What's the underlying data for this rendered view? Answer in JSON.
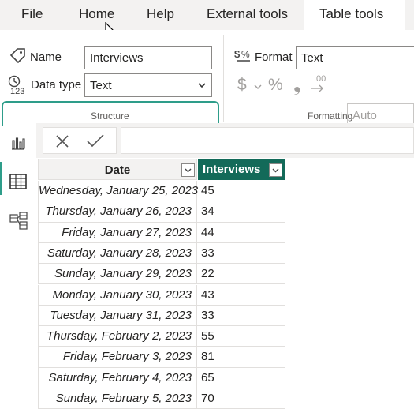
{
  "menu": {
    "tabs": [
      "File",
      "Home",
      "Help",
      "External tools",
      "Table tools"
    ],
    "active": "Table tools"
  },
  "ribbon": {
    "structure": {
      "name_label": "Name",
      "name_value": "Interviews",
      "datatype_label": "Data type",
      "datatype_value": "Text",
      "group_label": "Structure"
    },
    "formatting": {
      "format_label": "Format",
      "format_value": "Text",
      "currency_symbol": "$",
      "percent_symbol": "%",
      "comma_symbol": "❟",
      "decimal_symbol": ".00",
      "auto_placeholder": "Auto",
      "group_label": "Formatting"
    }
  },
  "left_rail": {
    "icons": [
      "report-view-icon",
      "table-view-icon",
      "model-view-icon"
    ],
    "active": "table-view-icon"
  },
  "table": {
    "columns": [
      "Date",
      "Interviews"
    ],
    "rows": [
      {
        "date": "Wednesday, January 25, 2023",
        "interviews": "45"
      },
      {
        "date": "Thursday, January 26, 2023",
        "interviews": "34"
      },
      {
        "date": "Friday, January 27, 2023",
        "interviews": "44"
      },
      {
        "date": "Saturday, January 28, 2023",
        "interviews": "33"
      },
      {
        "date": "Sunday, January 29, 2023",
        "interviews": "22"
      },
      {
        "date": "Monday, January 30, 2023",
        "interviews": "43"
      },
      {
        "date": "Tuesday, January 31, 2023",
        "interviews": "33"
      },
      {
        "date": "Thursday, February 2, 2023",
        "interviews": "55"
      },
      {
        "date": "Friday, February 3, 2023",
        "interviews": "81"
      },
      {
        "date": "Saturday, February 4, 2023",
        "interviews": "65"
      },
      {
        "date": "Sunday, February 5, 2023",
        "interviews": "70"
      }
    ]
  },
  "colors": {
    "accent": "#136a59",
    "highlight": "#2e9d8a"
  }
}
